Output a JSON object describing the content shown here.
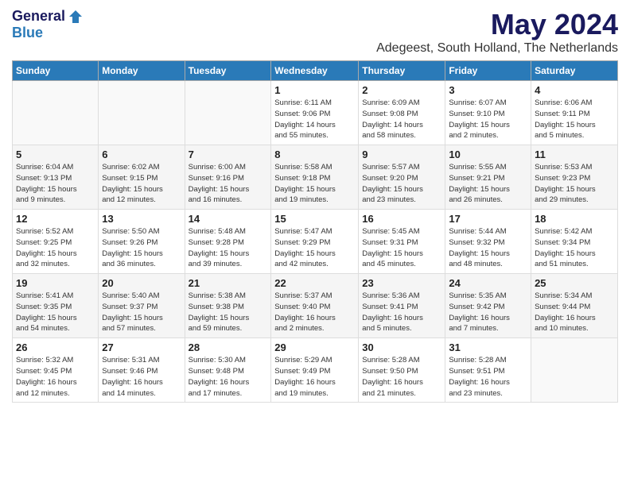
{
  "header": {
    "logo_general": "General",
    "logo_blue": "Blue",
    "month_title": "May 2024",
    "subtitle": "Adegeest, South Holland, The Netherlands"
  },
  "weekdays": [
    "Sunday",
    "Monday",
    "Tuesday",
    "Wednesday",
    "Thursday",
    "Friday",
    "Saturday"
  ],
  "weeks": [
    [
      {
        "day": "",
        "info": ""
      },
      {
        "day": "",
        "info": ""
      },
      {
        "day": "",
        "info": ""
      },
      {
        "day": "1",
        "info": "Sunrise: 6:11 AM\nSunset: 9:06 PM\nDaylight: 14 hours\nand 55 minutes."
      },
      {
        "day": "2",
        "info": "Sunrise: 6:09 AM\nSunset: 9:08 PM\nDaylight: 14 hours\nand 58 minutes."
      },
      {
        "day": "3",
        "info": "Sunrise: 6:07 AM\nSunset: 9:10 PM\nDaylight: 15 hours\nand 2 minutes."
      },
      {
        "day": "4",
        "info": "Sunrise: 6:06 AM\nSunset: 9:11 PM\nDaylight: 15 hours\nand 5 minutes."
      }
    ],
    [
      {
        "day": "5",
        "info": "Sunrise: 6:04 AM\nSunset: 9:13 PM\nDaylight: 15 hours\nand 9 minutes."
      },
      {
        "day": "6",
        "info": "Sunrise: 6:02 AM\nSunset: 9:15 PM\nDaylight: 15 hours\nand 12 minutes."
      },
      {
        "day": "7",
        "info": "Sunrise: 6:00 AM\nSunset: 9:16 PM\nDaylight: 15 hours\nand 16 minutes."
      },
      {
        "day": "8",
        "info": "Sunrise: 5:58 AM\nSunset: 9:18 PM\nDaylight: 15 hours\nand 19 minutes."
      },
      {
        "day": "9",
        "info": "Sunrise: 5:57 AM\nSunset: 9:20 PM\nDaylight: 15 hours\nand 23 minutes."
      },
      {
        "day": "10",
        "info": "Sunrise: 5:55 AM\nSunset: 9:21 PM\nDaylight: 15 hours\nand 26 minutes."
      },
      {
        "day": "11",
        "info": "Sunrise: 5:53 AM\nSunset: 9:23 PM\nDaylight: 15 hours\nand 29 minutes."
      }
    ],
    [
      {
        "day": "12",
        "info": "Sunrise: 5:52 AM\nSunset: 9:25 PM\nDaylight: 15 hours\nand 32 minutes."
      },
      {
        "day": "13",
        "info": "Sunrise: 5:50 AM\nSunset: 9:26 PM\nDaylight: 15 hours\nand 36 minutes."
      },
      {
        "day": "14",
        "info": "Sunrise: 5:48 AM\nSunset: 9:28 PM\nDaylight: 15 hours\nand 39 minutes."
      },
      {
        "day": "15",
        "info": "Sunrise: 5:47 AM\nSunset: 9:29 PM\nDaylight: 15 hours\nand 42 minutes."
      },
      {
        "day": "16",
        "info": "Sunrise: 5:45 AM\nSunset: 9:31 PM\nDaylight: 15 hours\nand 45 minutes."
      },
      {
        "day": "17",
        "info": "Sunrise: 5:44 AM\nSunset: 9:32 PM\nDaylight: 15 hours\nand 48 minutes."
      },
      {
        "day": "18",
        "info": "Sunrise: 5:42 AM\nSunset: 9:34 PM\nDaylight: 15 hours\nand 51 minutes."
      }
    ],
    [
      {
        "day": "19",
        "info": "Sunrise: 5:41 AM\nSunset: 9:35 PM\nDaylight: 15 hours\nand 54 minutes."
      },
      {
        "day": "20",
        "info": "Sunrise: 5:40 AM\nSunset: 9:37 PM\nDaylight: 15 hours\nand 57 minutes."
      },
      {
        "day": "21",
        "info": "Sunrise: 5:38 AM\nSunset: 9:38 PM\nDaylight: 15 hours\nand 59 minutes."
      },
      {
        "day": "22",
        "info": "Sunrise: 5:37 AM\nSunset: 9:40 PM\nDaylight: 16 hours\nand 2 minutes."
      },
      {
        "day": "23",
        "info": "Sunrise: 5:36 AM\nSunset: 9:41 PM\nDaylight: 16 hours\nand 5 minutes."
      },
      {
        "day": "24",
        "info": "Sunrise: 5:35 AM\nSunset: 9:42 PM\nDaylight: 16 hours\nand 7 minutes."
      },
      {
        "day": "25",
        "info": "Sunrise: 5:34 AM\nSunset: 9:44 PM\nDaylight: 16 hours\nand 10 minutes."
      }
    ],
    [
      {
        "day": "26",
        "info": "Sunrise: 5:32 AM\nSunset: 9:45 PM\nDaylight: 16 hours\nand 12 minutes."
      },
      {
        "day": "27",
        "info": "Sunrise: 5:31 AM\nSunset: 9:46 PM\nDaylight: 16 hours\nand 14 minutes."
      },
      {
        "day": "28",
        "info": "Sunrise: 5:30 AM\nSunset: 9:48 PM\nDaylight: 16 hours\nand 17 minutes."
      },
      {
        "day": "29",
        "info": "Sunrise: 5:29 AM\nSunset: 9:49 PM\nDaylight: 16 hours\nand 19 minutes."
      },
      {
        "day": "30",
        "info": "Sunrise: 5:28 AM\nSunset: 9:50 PM\nDaylight: 16 hours\nand 21 minutes."
      },
      {
        "day": "31",
        "info": "Sunrise: 5:28 AM\nSunset: 9:51 PM\nDaylight: 16 hours\nand 23 minutes."
      },
      {
        "day": "",
        "info": ""
      }
    ]
  ]
}
